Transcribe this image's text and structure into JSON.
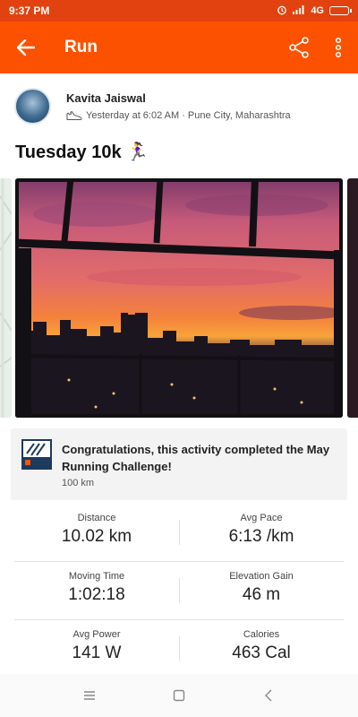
{
  "status": {
    "time": "9:37 PM",
    "network": "4G"
  },
  "appbar": {
    "title": "Run",
    "back_icon": "arrow-left-icon",
    "share_icon": "share-icon",
    "menu_icon": "more-vert-icon"
  },
  "activity": {
    "athlete_name": "Kavita Jaiswal",
    "timestamp_location": "Yesterday at 6:02 AM · Pune City, Maharashtra",
    "title": "Tuesday 10k",
    "title_emoji": "🏃‍♀️"
  },
  "challenge": {
    "text": "Congratulations, this activity completed the May Running Challenge!",
    "distance": "100 km"
  },
  "stats": [
    {
      "left": {
        "label": "Distance",
        "value": "10.02 km"
      },
      "right": {
        "label": "Avg Pace",
        "value": "6:13 /km"
      }
    },
    {
      "left": {
        "label": "Moving Time",
        "value": "1:02:18"
      },
      "right": {
        "label": "Elevation Gain",
        "value": "46 m"
      }
    },
    {
      "left": {
        "label": "Avg Power",
        "value": "141 W"
      },
      "right": {
        "label": "Calories",
        "value": "463 Cal"
      }
    }
  ],
  "colors": {
    "brand": "#fc5200",
    "statusbar": "#e2420f"
  }
}
